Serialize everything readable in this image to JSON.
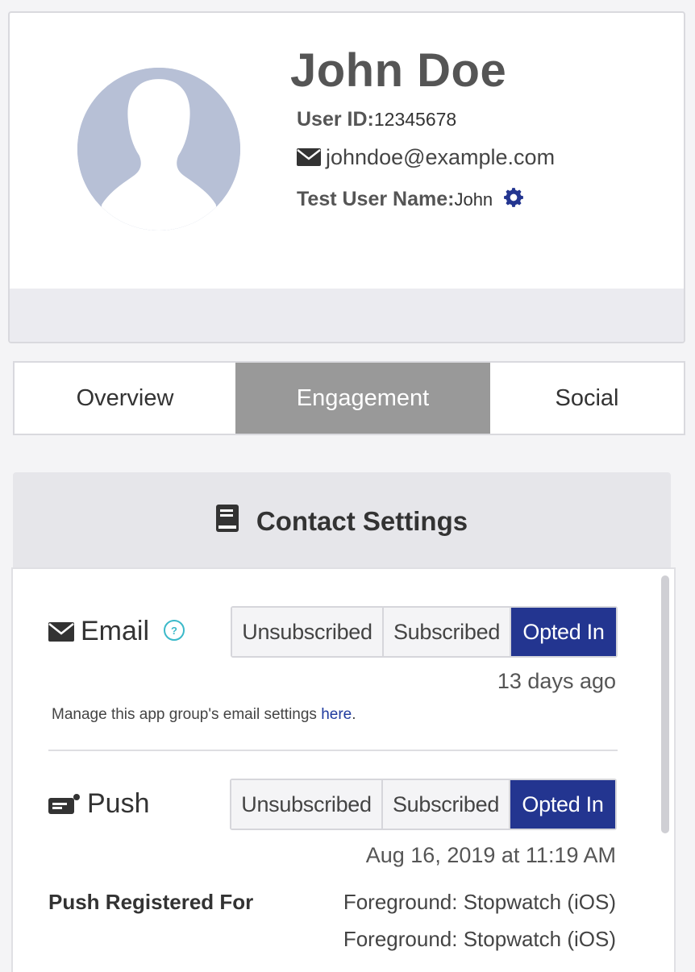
{
  "profile": {
    "name": "John Doe",
    "user_id_label": "User ID:",
    "user_id": "12345678",
    "email": "johndoe@example.com",
    "test_user_label": "Test User Name:",
    "test_user_name": "John"
  },
  "tabs": [
    {
      "label": "Overview",
      "active": false
    },
    {
      "label": "Engagement",
      "active": true
    },
    {
      "label": "Social",
      "active": false
    }
  ],
  "contact_settings": {
    "title": "Contact Settings",
    "email": {
      "label": "Email",
      "options": [
        "Unsubscribed",
        "Subscribed",
        "Opted In"
      ],
      "selected": "Opted In",
      "timestamp": "13 days ago",
      "manage_text": "Manage this app group's email settings",
      "manage_link": "here",
      "manage_suffix": "."
    },
    "push": {
      "label": "Push",
      "options": [
        "Unsubscribed",
        "Subscribed",
        "Opted In"
      ],
      "selected": "Opted In",
      "timestamp": "Aug 16, 2019 at 11:19 AM",
      "registered_label": "Push Registered For",
      "registered_items": [
        "Foreground: Stopwatch (iOS)",
        "Foreground: Stopwatch (iOS)"
      ]
    }
  },
  "colors": {
    "accent": "#233590",
    "link": "#1f3a9e",
    "active_tab": "#999999",
    "avatar": "#b7c0d6",
    "help_icon": "#3bb9c9"
  },
  "icons": [
    "envelope-icon",
    "gear-icon",
    "book-icon",
    "help-icon",
    "push-icon"
  ]
}
